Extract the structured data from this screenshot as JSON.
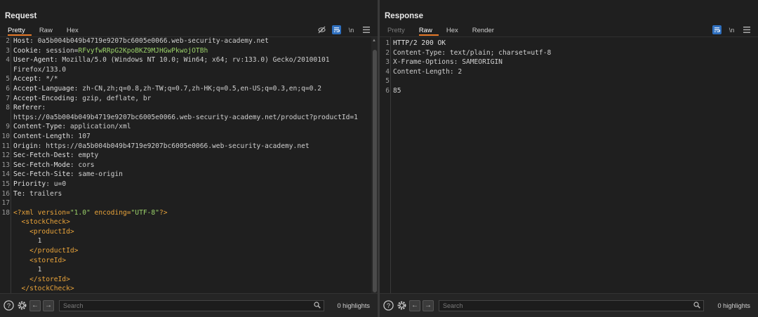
{
  "request": {
    "title": "Request",
    "tabs": [
      {
        "label": "Pretty",
        "active": true
      },
      {
        "label": "Raw",
        "active": false
      },
      {
        "label": "Hex",
        "active": false
      }
    ],
    "toolbar_icons": [
      "hide-icon",
      "wrap-icon",
      "newline-icon",
      "menu-icon"
    ],
    "newline_label": "\\n",
    "lines": [
      {
        "n": "2",
        "parts": [
          {
            "t": "Host",
            "c": "hname"
          },
          {
            "t": ": 0a5b004b049b4719e9207bc6005e0066.web-security-academy.net",
            "c": "hval"
          }
        ]
      },
      {
        "n": "3",
        "parts": [
          {
            "t": "Cookie",
            "c": "hname"
          },
          {
            "t": ": session=",
            "c": "hval"
          },
          {
            "t": "RFvyfwRRpG2KpoBKZ9MJHGwPkwojOTBh",
            "c": "cookie-val"
          }
        ]
      },
      {
        "n": "4",
        "parts": [
          {
            "t": "User-Agent",
            "c": "hname"
          },
          {
            "t": ": Mozilla/5.0 (Windows NT 10.0; Win64; x64; rv:133.0) Gecko/20100101",
            "c": "hval"
          }
        ]
      },
      {
        "n": "",
        "parts": [
          {
            "t": "Firefox/133.0",
            "c": "hval"
          }
        ]
      },
      {
        "n": "5",
        "parts": [
          {
            "t": "Accept",
            "c": "hname"
          },
          {
            "t": ": */*",
            "c": "hval"
          }
        ]
      },
      {
        "n": "6",
        "parts": [
          {
            "t": "Accept-Language",
            "c": "hname"
          },
          {
            "t": ": zh-CN,zh;q=0.8,zh-TW;q=0.7,zh-HK;q=0.5,en-US;q=0.3,en;q=0.2",
            "c": "hval"
          }
        ]
      },
      {
        "n": "7",
        "parts": [
          {
            "t": "Accept-Encoding",
            "c": "hname"
          },
          {
            "t": ": gzip, deflate, br",
            "c": "hval"
          }
        ]
      },
      {
        "n": "8",
        "parts": [
          {
            "t": "Referer",
            "c": "hname"
          },
          {
            "t": ":",
            "c": "hval"
          }
        ]
      },
      {
        "n": "",
        "parts": [
          {
            "t": "https://0a5b004b049b4719e9207bc6005e0066.web-security-academy.net/product?productId=1",
            "c": "hval"
          }
        ]
      },
      {
        "n": "9",
        "parts": [
          {
            "t": "Content-Type",
            "c": "hname"
          },
          {
            "t": ": application/xml",
            "c": "hval"
          }
        ]
      },
      {
        "n": "10",
        "parts": [
          {
            "t": "Content-Length",
            "c": "hname"
          },
          {
            "t": ": 107",
            "c": "hval"
          }
        ]
      },
      {
        "n": "11",
        "parts": [
          {
            "t": "Origin",
            "c": "hname"
          },
          {
            "t": ": https://0a5b004b049b4719e9207bc6005e0066.web-security-academy.net",
            "c": "hval"
          }
        ]
      },
      {
        "n": "12",
        "parts": [
          {
            "t": "Sec-Fetch-Dest",
            "c": "hname"
          },
          {
            "t": ": empty",
            "c": "hval"
          }
        ]
      },
      {
        "n": "13",
        "parts": [
          {
            "t": "Sec-Fetch-Mode",
            "c": "hname"
          },
          {
            "t": ": cors",
            "c": "hval"
          }
        ]
      },
      {
        "n": "14",
        "parts": [
          {
            "t": "Sec-Fetch-Site",
            "c": "hname"
          },
          {
            "t": ": same-origin",
            "c": "hval"
          }
        ]
      },
      {
        "n": "15",
        "parts": [
          {
            "t": "Priority",
            "c": "hname"
          },
          {
            "t": ": u=0",
            "c": "hval"
          }
        ]
      },
      {
        "n": "16",
        "parts": [
          {
            "t": "Te",
            "c": "hname"
          },
          {
            "t": ": trailers",
            "c": "hval"
          }
        ]
      },
      {
        "n": "17",
        "parts": []
      },
      {
        "n": "18",
        "parts": [
          {
            "t": "<?xml version=",
            "c": "xml-tag"
          },
          {
            "t": "\"1.0\"",
            "c": "xml-str"
          },
          {
            "t": " encoding=",
            "c": "xml-tag"
          },
          {
            "t": "\"UTF-8\"",
            "c": "xml-str"
          },
          {
            "t": "?>",
            "c": "xml-tag"
          }
        ]
      },
      {
        "n": "",
        "parts": [
          {
            "t": "  <stockCheck>",
            "c": "xml-tag"
          }
        ]
      },
      {
        "n": "",
        "parts": [
          {
            "t": "    <productId>",
            "c": "xml-tag"
          }
        ]
      },
      {
        "n": "",
        "parts": [
          {
            "t": "      1",
            "c": "xml-txt"
          }
        ]
      },
      {
        "n": "",
        "parts": [
          {
            "t": "    </productId>",
            "c": "xml-tag"
          }
        ]
      },
      {
        "n": "",
        "parts": [
          {
            "t": "    <storeId>",
            "c": "xml-tag"
          }
        ]
      },
      {
        "n": "",
        "parts": [
          {
            "t": "      1",
            "c": "xml-txt"
          }
        ]
      },
      {
        "n": "",
        "parts": [
          {
            "t": "    </storeId>",
            "c": "xml-tag"
          }
        ]
      },
      {
        "n": "",
        "parts": [
          {
            "t": "  </stockCheck>",
            "c": "xml-tag"
          }
        ]
      }
    ],
    "search_placeholder": "Search",
    "highlights": "0 highlights"
  },
  "response": {
    "title": "Response",
    "tabs": [
      {
        "label": "Pretty",
        "active": false,
        "dim": true
      },
      {
        "label": "Raw",
        "active": true
      },
      {
        "label": "Hex",
        "active": false
      },
      {
        "label": "Render",
        "active": false
      }
    ],
    "newline_label": "\\n",
    "lines": [
      {
        "n": "1",
        "parts": [
          {
            "t": "HTTP/2 200 OK",
            "c": "hname"
          }
        ]
      },
      {
        "n": "2",
        "parts": [
          {
            "t": "Content-Type: text/plain; charset=utf-8",
            "c": "hval"
          }
        ]
      },
      {
        "n": "3",
        "parts": [
          {
            "t": "X-Frame-Options: SAMEORIGIN",
            "c": "hval"
          }
        ]
      },
      {
        "n": "4",
        "parts": [
          {
            "t": "Content-Length: 2",
            "c": "hval"
          }
        ]
      },
      {
        "n": "5",
        "parts": []
      },
      {
        "n": "6",
        "parts": [
          {
            "t": "85",
            "c": "hval"
          }
        ]
      }
    ],
    "search_placeholder": "Search",
    "highlights": "0 highlights"
  },
  "colors": {
    "accent_tab": "#e87a2a",
    "toggle_blue": "#2e6fbf",
    "cookie_green": "#9bd26a",
    "xml_orange": "#e8a33a"
  }
}
